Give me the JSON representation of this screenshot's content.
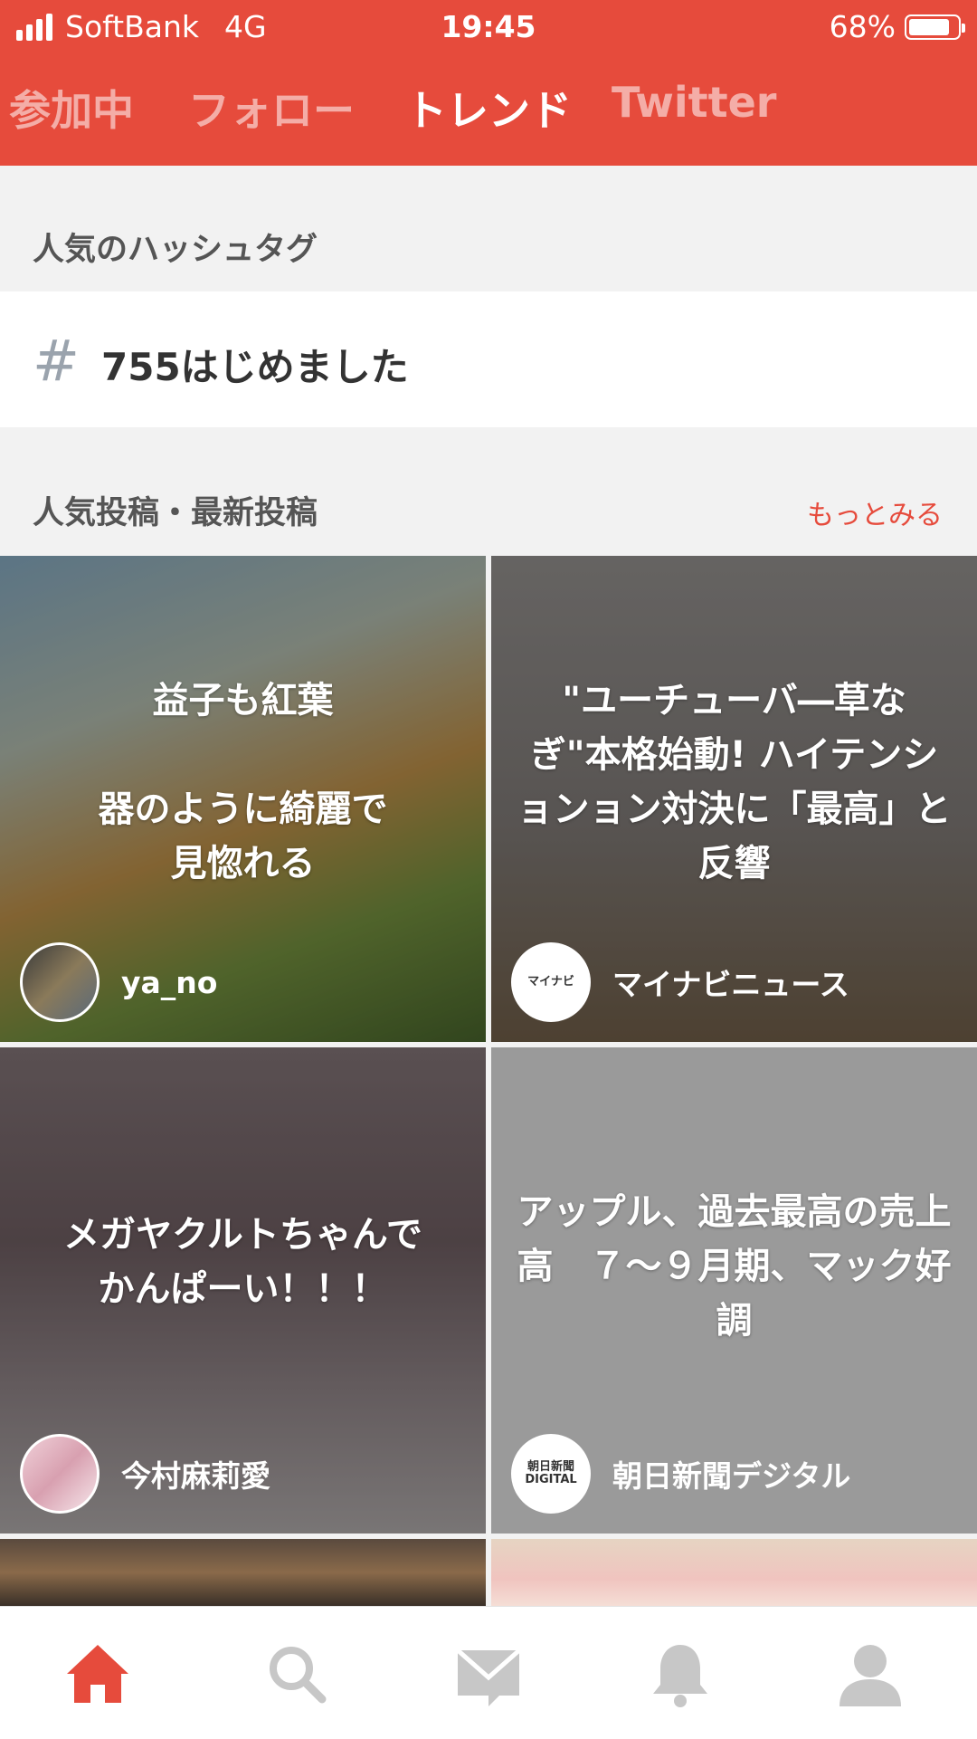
{
  "status": {
    "carrier": "SoftBank",
    "network": "4G",
    "time": "19:45",
    "battery": "68%",
    "battery_level": 0.68
  },
  "tabs": [
    {
      "label": "参加中",
      "active": false
    },
    {
      "label": "フォロー",
      "active": false
    },
    {
      "label": "トレンド",
      "active": true
    },
    {
      "label": "Twitter",
      "active": false
    }
  ],
  "hashtags": {
    "title": "人気のハッシュタグ",
    "symbol": "#",
    "items": [
      "755はじめました"
    ]
  },
  "posts": {
    "title": "人気投稿・最新投稿",
    "more_label": "もっとみる",
    "items": [
      {
        "caption": "益子も紅葉\n\n器のように綺麗で\n見惚れる",
        "author": "ya_no"
      },
      {
        "caption": "\"ユーチューバ―草なぎ\"本格始動! ハイテンションョン対決に「最高」と反響",
        "author": "マイナビニュース",
        "avatar_text": "マイナビ"
      },
      {
        "caption": "メガヤクルトちゃんで\nかんぱーい！！！",
        "author": "今村麻莉愛"
      },
      {
        "caption": "アップル、過去最高の売上高　７～９月期、マック好調",
        "author": "朝日新聞デジタル",
        "avatar_text": "朝日新聞 DIGITAL"
      }
    ]
  },
  "nav": [
    {
      "icon": "home-icon",
      "active": true
    },
    {
      "icon": "search-icon",
      "active": false
    },
    {
      "icon": "mail-icon",
      "active": false
    },
    {
      "icon": "bell-icon",
      "active": false
    },
    {
      "icon": "profile-icon",
      "active": false
    }
  ],
  "colors": {
    "accent": "#e64b3c",
    "inactive_icon": "#c7c7c7"
  }
}
